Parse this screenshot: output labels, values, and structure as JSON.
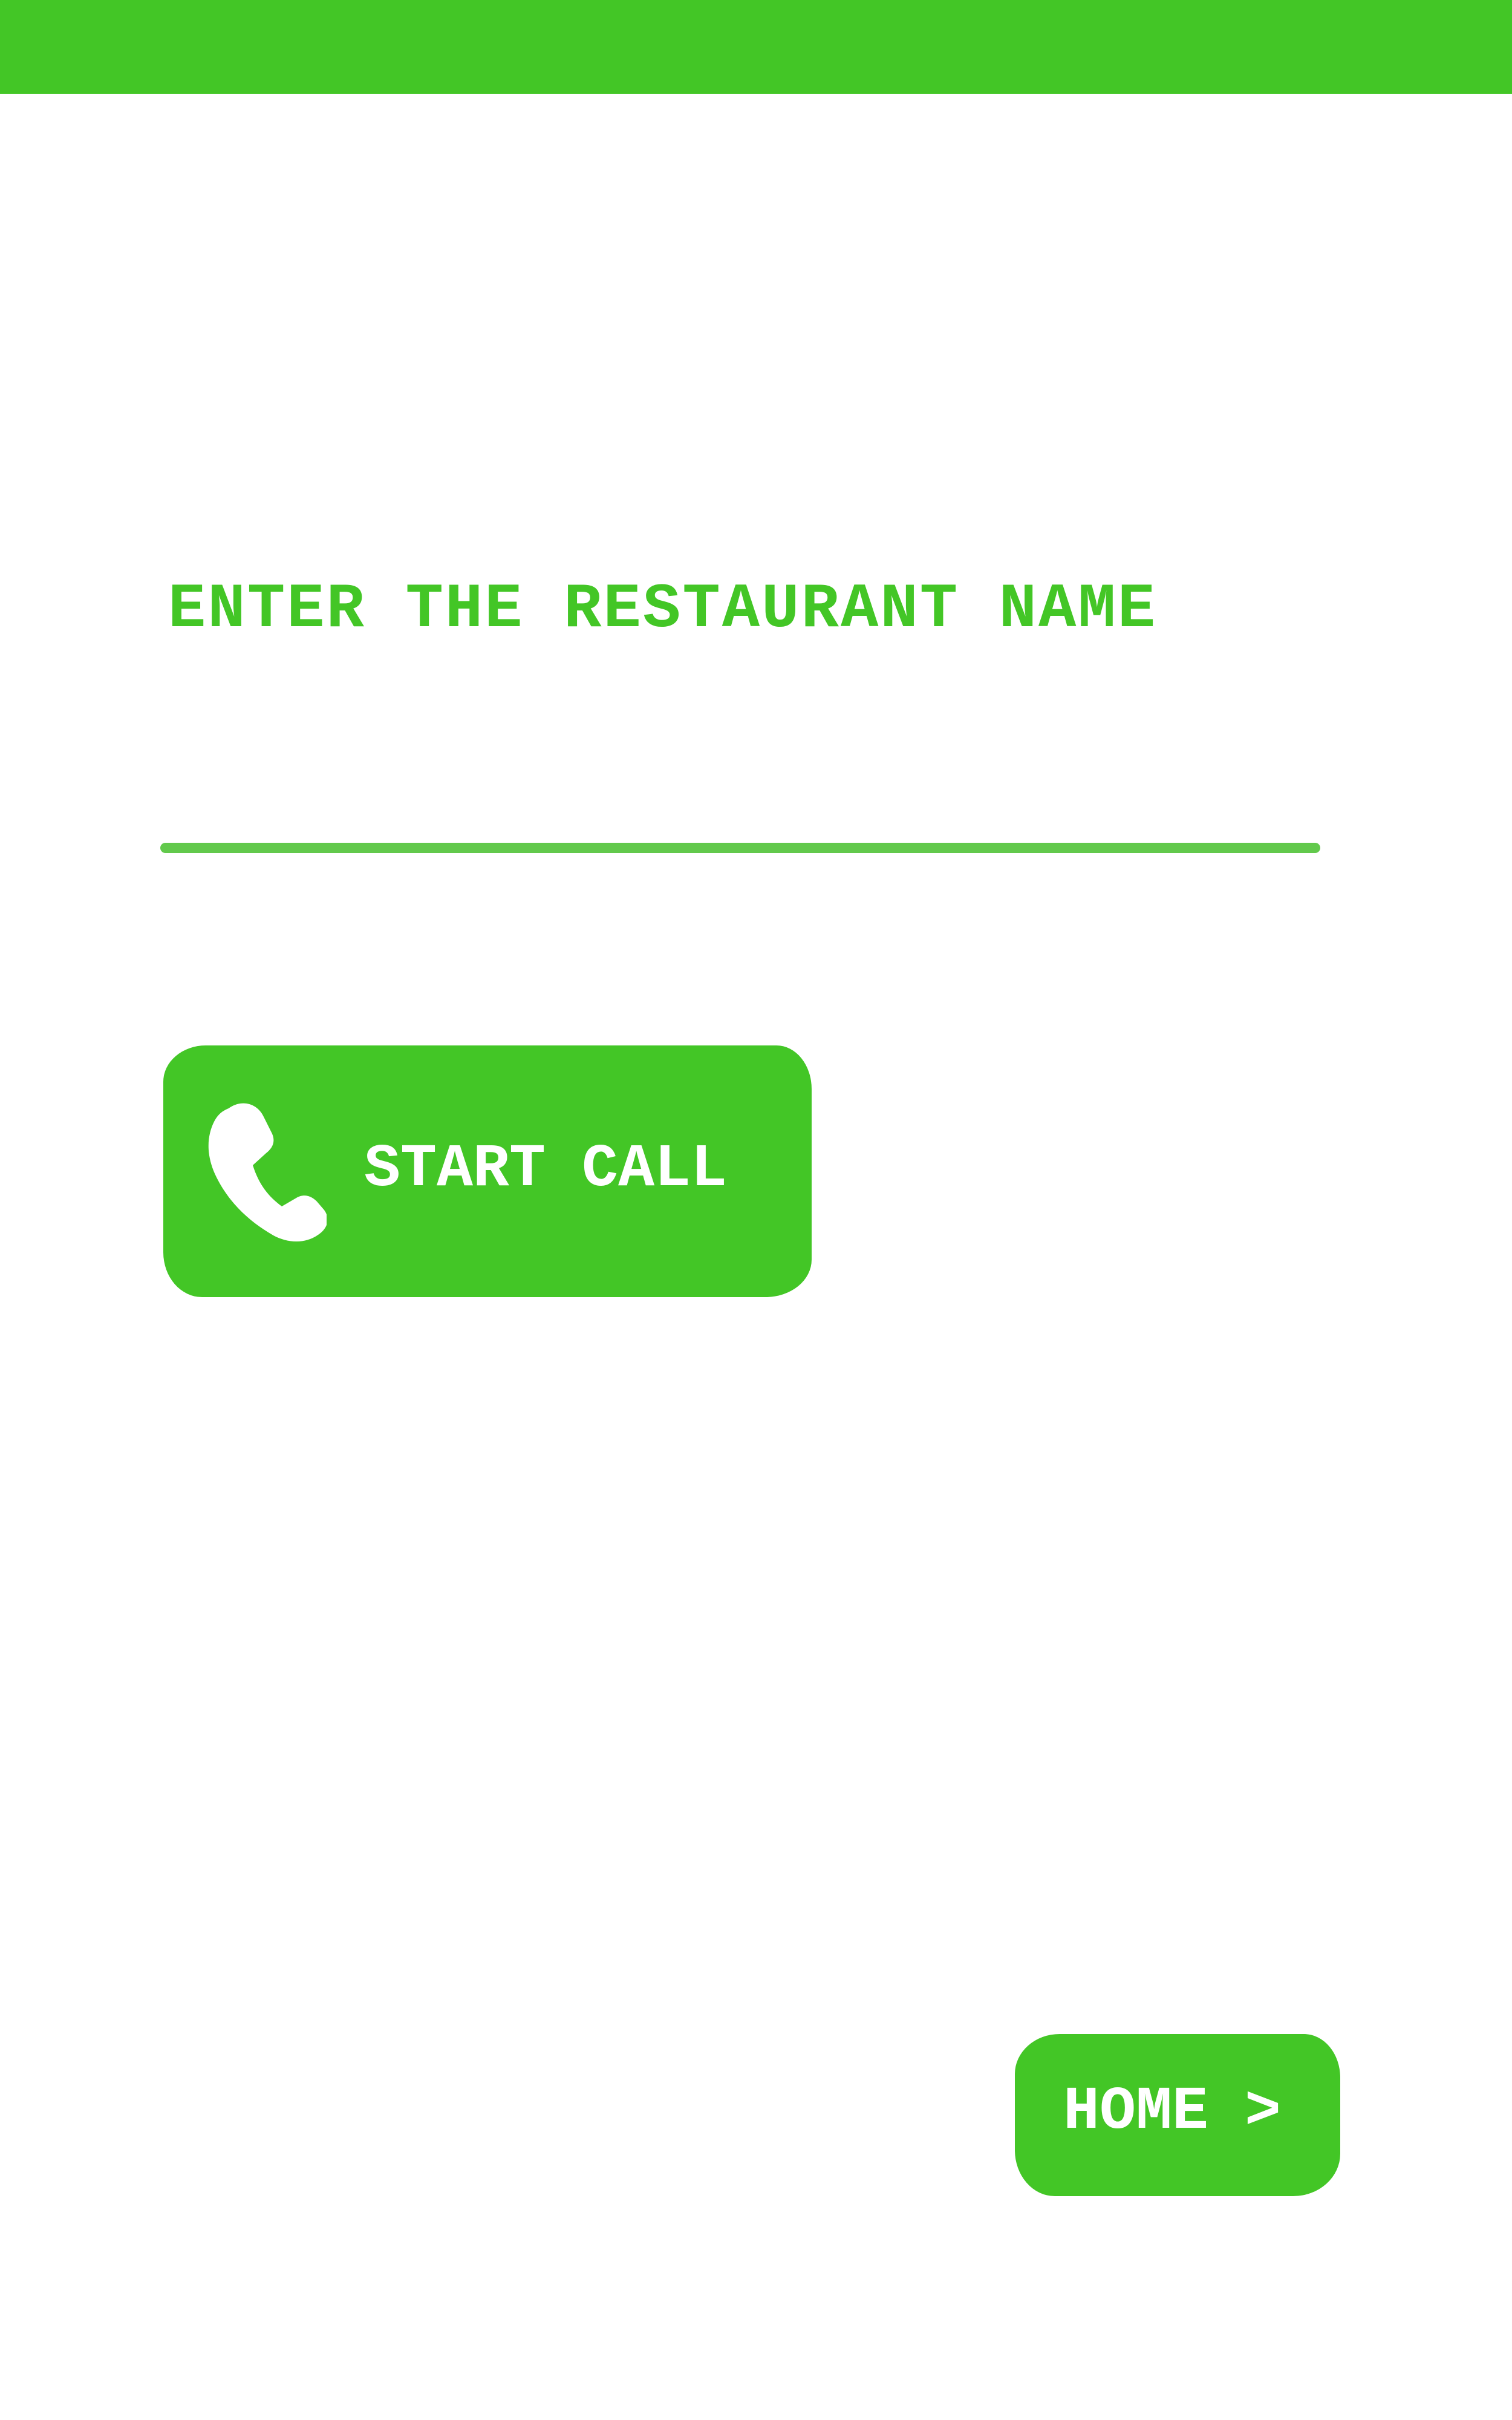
{
  "header": {
    "bar_color": "#43c626"
  },
  "form": {
    "prompt": "ENTER THE RESTAURANT NAME",
    "input_value": "",
    "input_placeholder": ""
  },
  "actions": {
    "start_call_label": "START CALL",
    "start_call_icon": "phone-icon",
    "home_label": "HOME >"
  },
  "colors": {
    "accent": "#43c626",
    "underline": "#62c94c",
    "background": "#ffffff",
    "button_text": "#ffffff"
  }
}
